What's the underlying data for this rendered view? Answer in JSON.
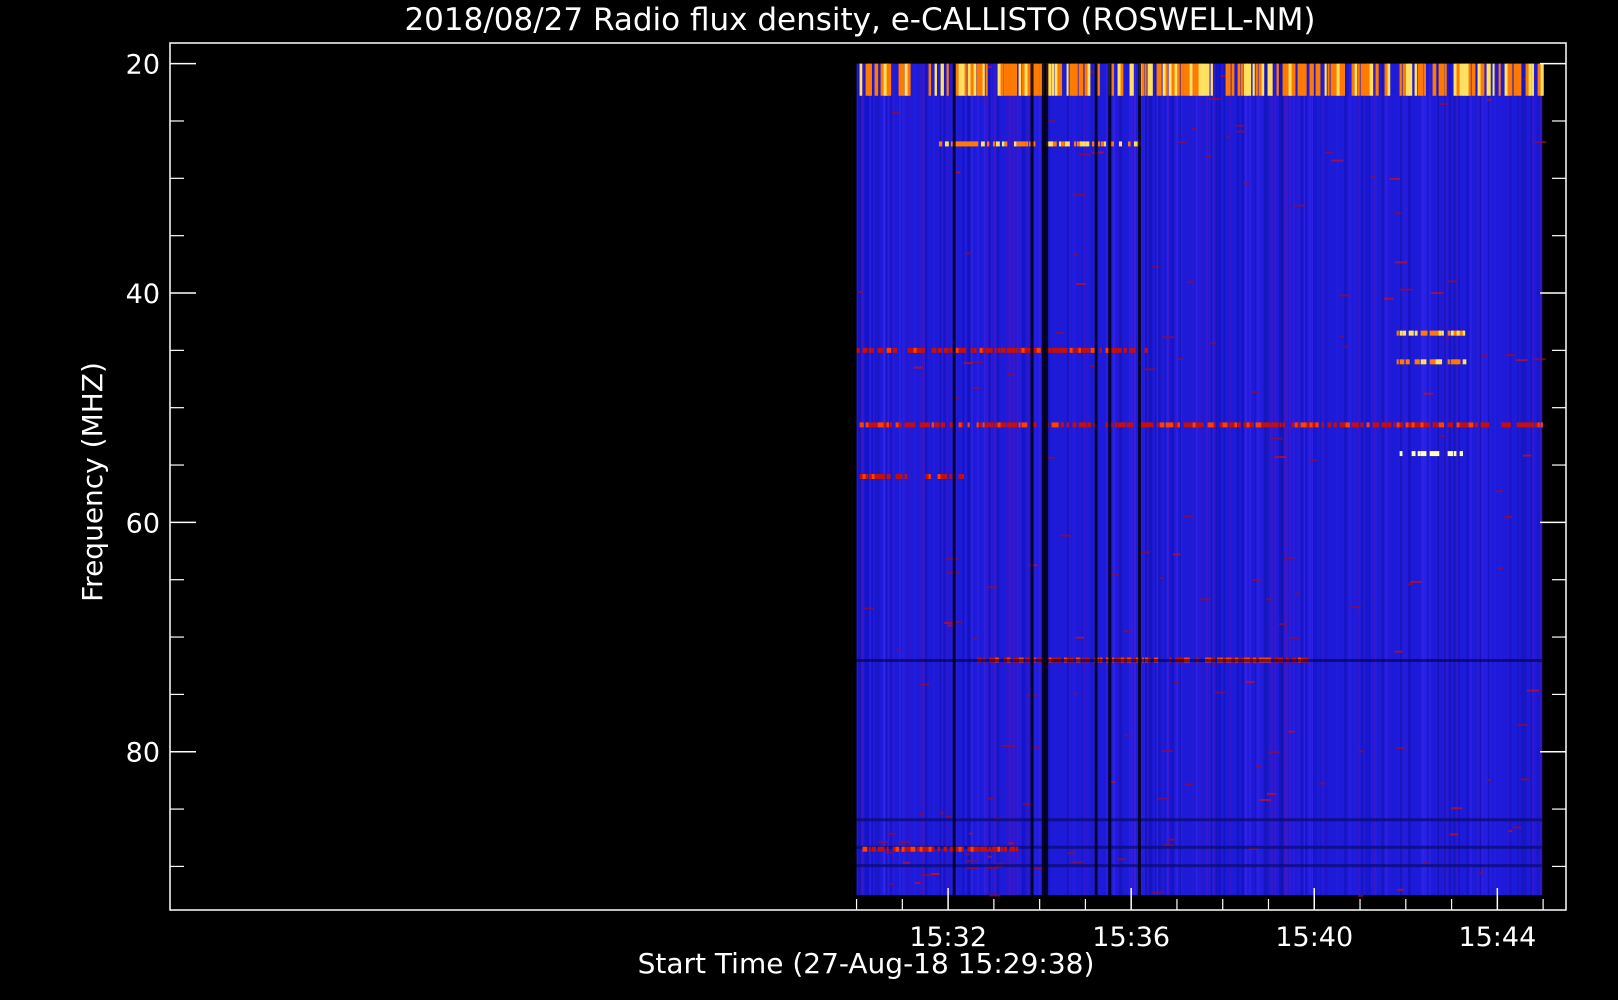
{
  "chart_data": {
    "type": "heatmap",
    "title": "2018/08/27  Radio flux density, e-CALLISTO (ROSWELL-NM)",
    "xlabel": "Start Time (27-Aug-18 15:29:38)",
    "ylabel": "Frequency (MHZ)",
    "x_range_minutes": [
      15.0,
      45.5
    ],
    "data_time_range_minutes": [
      30.0,
      44.97
    ],
    "y_range_mhz": [
      18.2,
      93.8
    ],
    "data_freq_range_mhz": [
      20.0,
      92.5
    ],
    "y_ticks": [
      {
        "value": 20,
        "label": "20"
      },
      {
        "value": 40,
        "label": "40"
      },
      {
        "value": 60,
        "label": "60"
      },
      {
        "value": 80,
        "label": "80"
      }
    ],
    "y_minor_ticks": [
      25,
      30,
      35,
      45,
      50,
      55,
      65,
      70,
      75,
      85,
      90
    ],
    "x_ticks": [
      {
        "value": 32,
        "label": "15:32"
      },
      {
        "value": 36,
        "label": "15:36"
      },
      {
        "value": 40,
        "label": "15:40"
      },
      {
        "value": 44,
        "label": "15:44"
      }
    ],
    "x_minor_ticks": [
      30,
      31,
      33,
      34,
      35,
      37,
      38,
      39,
      41,
      42,
      43,
      45
    ],
    "y_inverted": true,
    "colormap": [
      "#000000",
      "#0000c8",
      "#3a1ee0",
      "#b00000",
      "#ff3000",
      "#ff9000",
      "#ffff60",
      "#ffffff"
    ],
    "background_level": "blue",
    "vertical_dropouts_minutes": [
      32.1,
      33.8,
      34.05,
      34.1,
      35.2,
      35.5,
      36.15
    ],
    "horizontal_bands": [
      {
        "freq_mhz": 20.5,
        "level": "hot",
        "t_start": 30.0,
        "t_end": 45.0
      },
      {
        "freq_mhz": 27.0,
        "level": "hot",
        "t_start": 31.8,
        "t_end": 36.3
      },
      {
        "freq_mhz": 45.0,
        "level": "warm",
        "t_start": 30.0,
        "t_end": 36.4
      },
      {
        "freq_mhz": 43.5,
        "level": "hot",
        "t_start": 41.8,
        "t_end": 43.3
      },
      {
        "freq_mhz": 46.0,
        "level": "hot",
        "t_start": 41.8,
        "t_end": 43.3
      },
      {
        "freq_mhz": 51.5,
        "level": "warm",
        "t_start": 30.0,
        "t_end": 45.0
      },
      {
        "freq_mhz": 54.0,
        "level": "white",
        "t_start": 41.8,
        "t_end": 43.3
      },
      {
        "freq_mhz": 56.0,
        "level": "warm",
        "t_start": 30.0,
        "t_end": 32.3
      },
      {
        "freq_mhz": 72.0,
        "level": "warm",
        "t_start": 32.5,
        "t_end": 39.8
      },
      {
        "freq_mhz": 88.5,
        "level": "warm",
        "t_start": 30.0,
        "t_end": 33.5
      }
    ]
  }
}
